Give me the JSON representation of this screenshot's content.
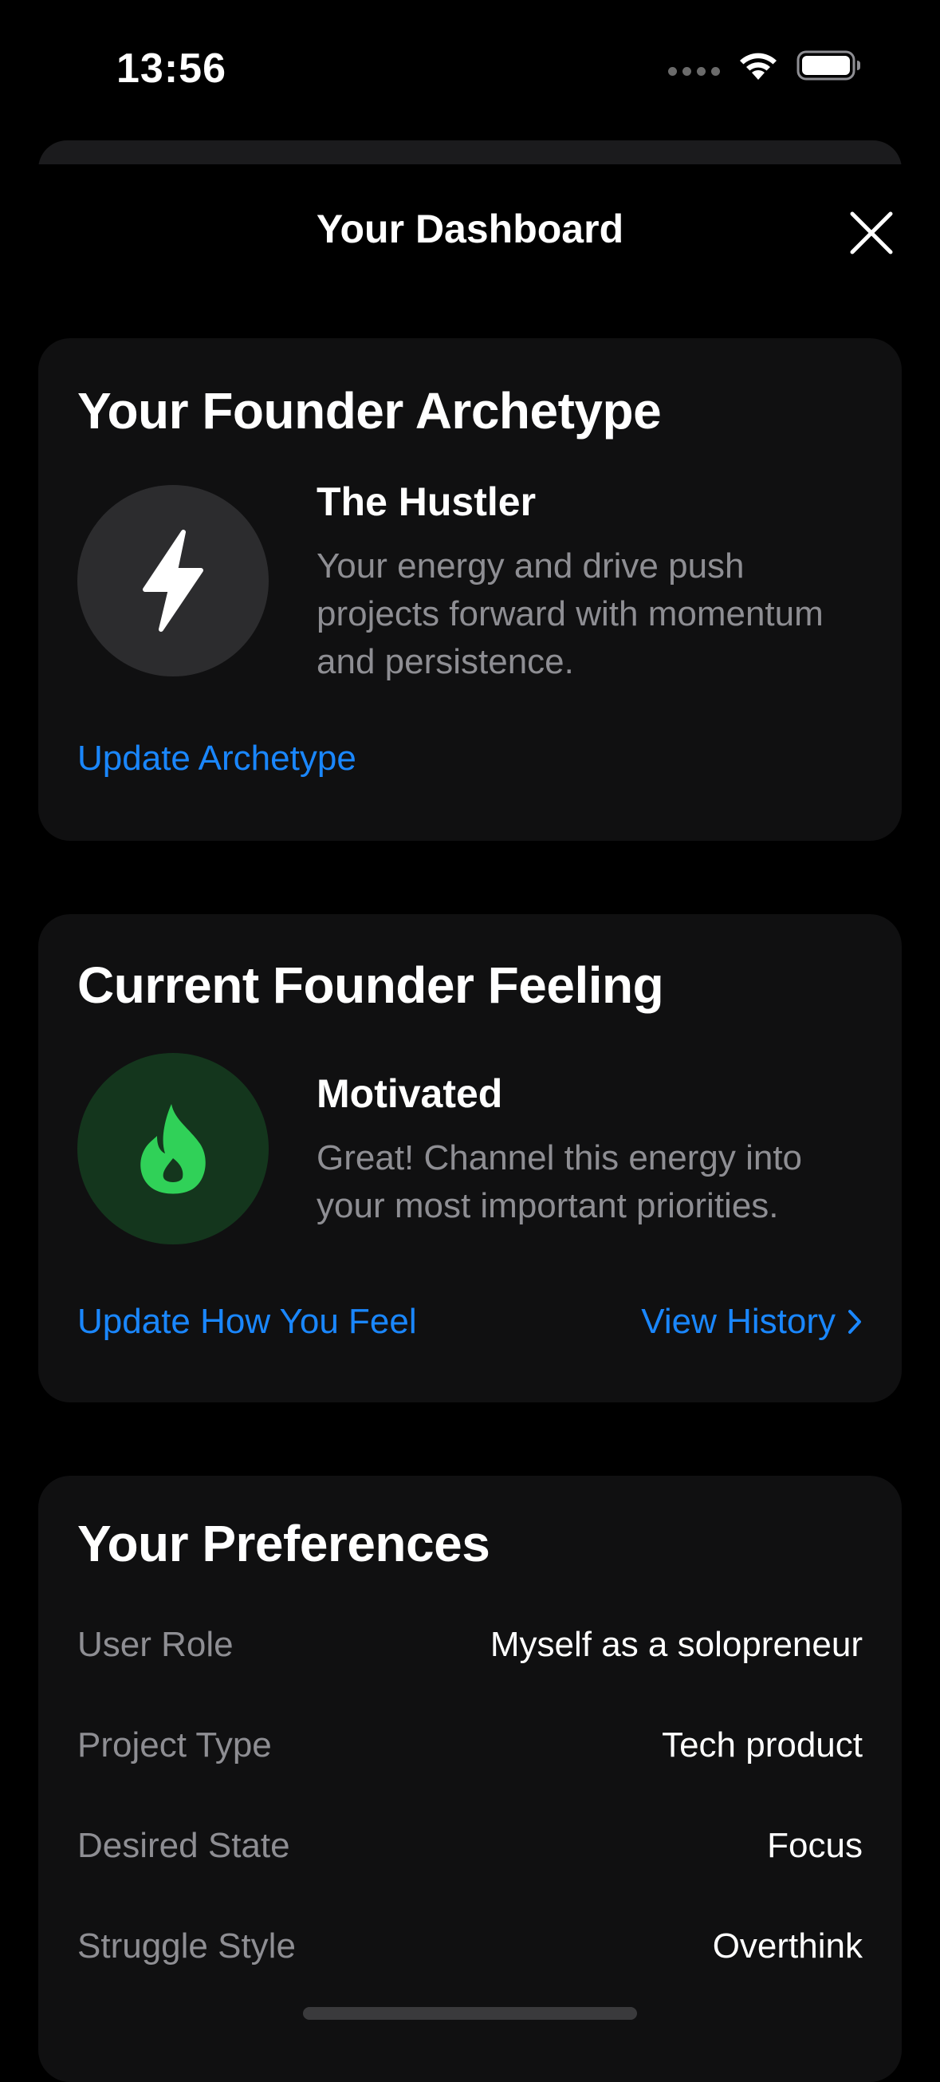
{
  "status_bar": {
    "time": "13:56"
  },
  "nav": {
    "title": "Your Dashboard",
    "close_icon": "close-icon"
  },
  "archetype": {
    "title": "Your Founder Archetype",
    "icon": "lightning-bolt-icon",
    "name": "The Hustler",
    "description": "Your energy and drive push projects forward with momentum and persistence.",
    "update_link": "Update Archetype",
    "icon_bg": "#2c2c2e"
  },
  "feeling": {
    "title": "Current Founder Feeling",
    "icon": "flame-icon",
    "name": "Motivated",
    "description": "Great! Channel this energy into your most important priorities.",
    "update_link": "Update How You Feel",
    "history_link": "View History",
    "accent": "#30d158",
    "icon_bg": "#14361d"
  },
  "preferences": {
    "title": "Your Preferences",
    "rows": [
      {
        "label": "User Role",
        "value": "Myself as a solopreneur"
      },
      {
        "label": "Project Type",
        "value": "Tech product"
      },
      {
        "label": "Desired State",
        "value": "Focus"
      },
      {
        "label": "Struggle Style",
        "value": "Overthink"
      }
    ]
  },
  "colors": {
    "background": "#000000",
    "card": "#101011",
    "link": "#1a87ff",
    "secondary_text": "#8e8e93"
  }
}
